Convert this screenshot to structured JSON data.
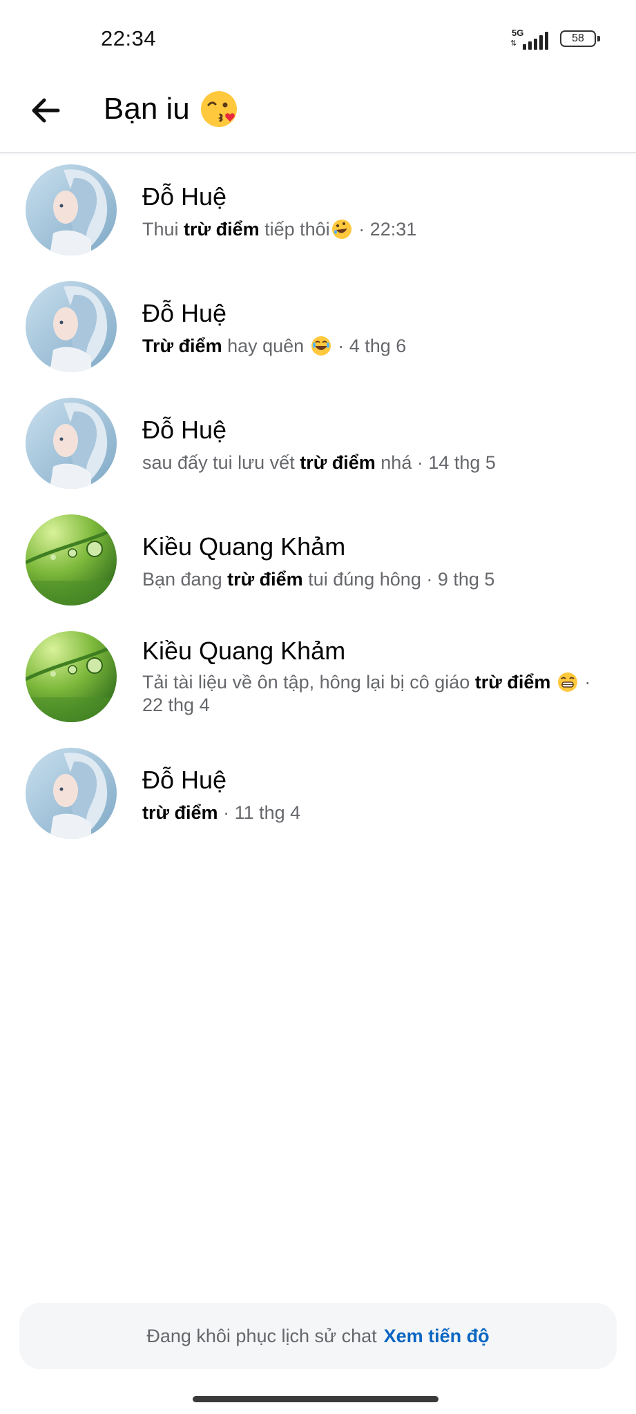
{
  "status_bar": {
    "time": "22:34",
    "network": "5G",
    "battery": "58"
  },
  "header": {
    "title": "Bạn iu",
    "title_emoji": "kissing-heart-emoji"
  },
  "results": [
    {
      "name": "Đỗ Huệ",
      "avatar": "girl-avatar",
      "pre": "Thui ",
      "highlight": "trừ điểm",
      "post": " tiếp thôi",
      "emoji": "rofl-emoji",
      "time": " · 22:31"
    },
    {
      "name": "Đỗ Huệ",
      "avatar": "girl-avatar",
      "pre": "",
      "highlight": "Trừ điểm",
      "post": " hay quên",
      "emoji": "joy-emoji",
      "time": " · 4 thg 6"
    },
    {
      "name": "Đỗ Huệ",
      "avatar": "girl-avatar",
      "pre": "sau đấy tui lưu vết ",
      "highlight": "trừ điểm",
      "post": " nhá ",
      "emoji": "",
      "time": " · 14 thg 5"
    },
    {
      "name": "Kiều Quang Khảm",
      "avatar": "grass-dewdrop-avatar",
      "pre": "Bạn đang ",
      "highlight": "trừ điểm",
      "post": " tui đúng hông",
      "emoji": "",
      "time": " · 9 thg 5"
    },
    {
      "name": "Kiều Quang Khảm",
      "avatar": "grass-dewdrop-avatar",
      "pre": "Tải tài liệu về ôn tập, hông lại bị cô giáo ",
      "highlight": "trừ điểm",
      "post": " ",
      "emoji": "grin-emoji",
      "time": " · 22 thg 4"
    },
    {
      "name": "Đỗ Huệ",
      "avatar": "girl-avatar",
      "pre": "",
      "highlight": "trừ điểm",
      "post": " ",
      "emoji": "",
      "time": " · 11 thg 4"
    }
  ],
  "banner": {
    "text": "Đang khôi phục lịch sử chat",
    "link": "Xem tiến độ"
  },
  "colors": {
    "link": "#0a66c2",
    "secondary_text": "#65676b",
    "primary_text": "#050505"
  }
}
